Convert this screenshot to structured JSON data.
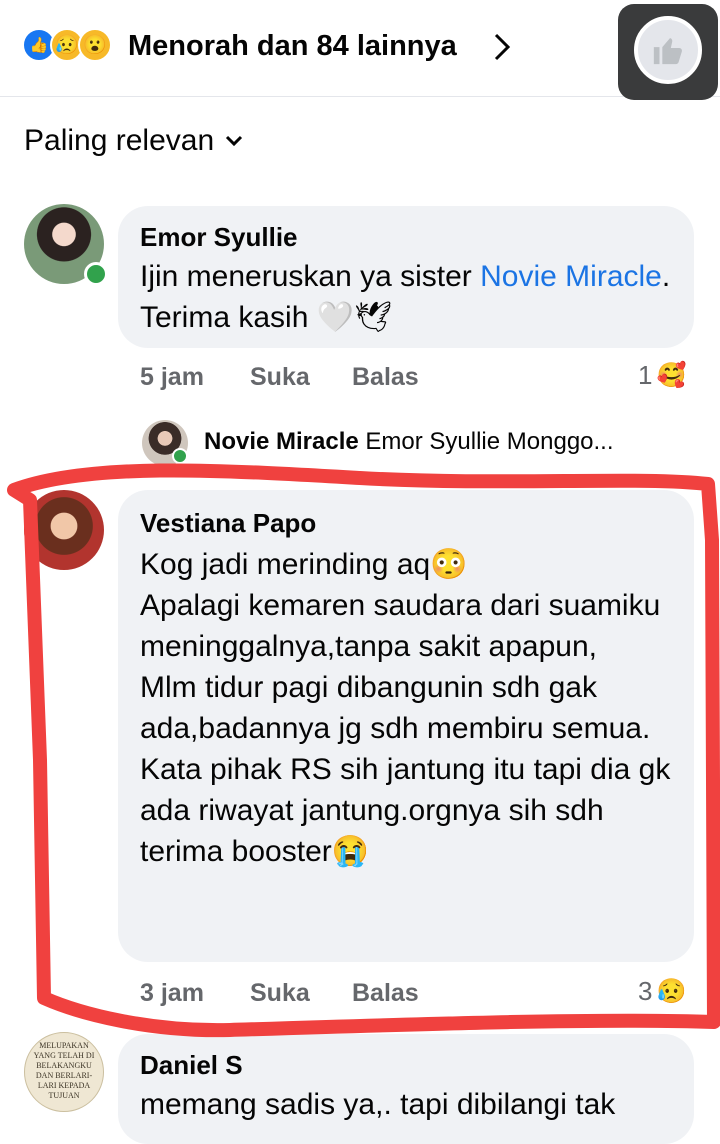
{
  "header": {
    "reaction_icons": [
      "like-icon",
      "sad-icon",
      "wow-icon"
    ],
    "reactions_text": "Menorah dan 84 lainnya"
  },
  "sort": {
    "label": "Paling relevan"
  },
  "comments": [
    {
      "name": "Emor Syullie",
      "text_before": "Ijin meneruskan ya sister ",
      "mention": "Novie Miracle",
      "text_after": ". Terima kasih 🤍🕊",
      "time": "5 jam",
      "like": "Suka",
      "reply": "Balas",
      "reaction_count": "1",
      "reaction_emoji": "🥰",
      "online": true
    },
    {
      "name": "Vestiana Papo",
      "text": "Kog jadi merinding aq😳\nApalagi kemaren saudara dari suamiku meninggalnya,tanpa sakit apapun,\nMlm tidur pagi dibangunin sdh gak ada,badannya jg sdh membiru semua.\nKata pihak RS sih jantung itu tapi dia gk ada riwayat jantung.orgnya sih sdh terima booster😭",
      "time": "3 jam",
      "like": "Suka",
      "reply": "Balas",
      "reaction_count": "3",
      "reaction_emoji": "😥"
    },
    {
      "name": "Daniel S",
      "text": "memang sadis ya,. tapi dibilangi tak",
      "avatar_caption": "MELUPAKAN YANG TELAH DI BELAKANGKU DAN BERLARI-LARI KEPADA TUJUAN"
    }
  ],
  "reply_preview": {
    "name": "Novie Miracle",
    "text": "Emor Syullie Monggo..."
  },
  "colors": {
    "highlight_red": "#f0413f",
    "link_blue": "#1b74e4",
    "bubble_gray": "#f0f2f5"
  }
}
